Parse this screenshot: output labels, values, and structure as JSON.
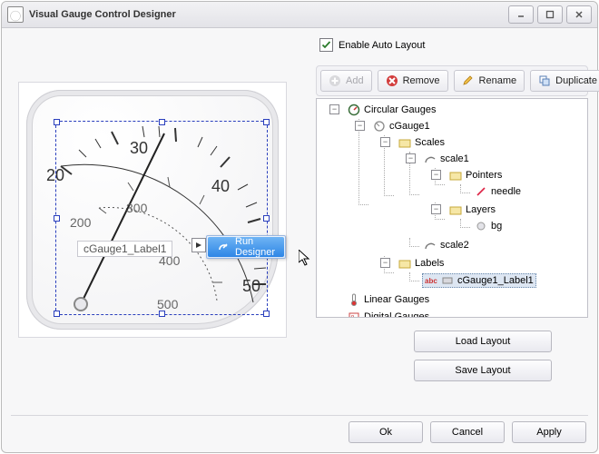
{
  "window": {
    "title": "Visual Gauge Control Designer"
  },
  "autoLayout": {
    "label": "Enable Auto Layout",
    "checked": true
  },
  "toolbar": {
    "add": "Add",
    "remove": "Remove",
    "rename": "Rename",
    "duplicate": "Duplicate"
  },
  "tree": {
    "root": "Circular Gauges",
    "cGauge1": "cGauge1",
    "scales": "Scales",
    "scale1": "scale1",
    "pointers": "Pointers",
    "needle": "needle",
    "layers": "Layers",
    "bg": "bg",
    "scale2": "scale2",
    "labels": "Labels",
    "cLabel": "cGauge1_Label1",
    "linear": "Linear Gauges",
    "digital": "Digital Gauges"
  },
  "layout": {
    "load": "Load Layout",
    "save": "Save Layout"
  },
  "dialog": {
    "ok": "Ok",
    "cancel": "Cancel",
    "apply": "Apply"
  },
  "preview": {
    "label": "cGauge1_Label1",
    "smart_item": "Run Designer",
    "outer_ticks": {
      "n20": "20",
      "n30": "30",
      "n40": "40",
      "n50": "50"
    },
    "inner_ticks": {
      "n200": "200",
      "n300": "300",
      "n400": "400",
      "n500": "500"
    }
  }
}
